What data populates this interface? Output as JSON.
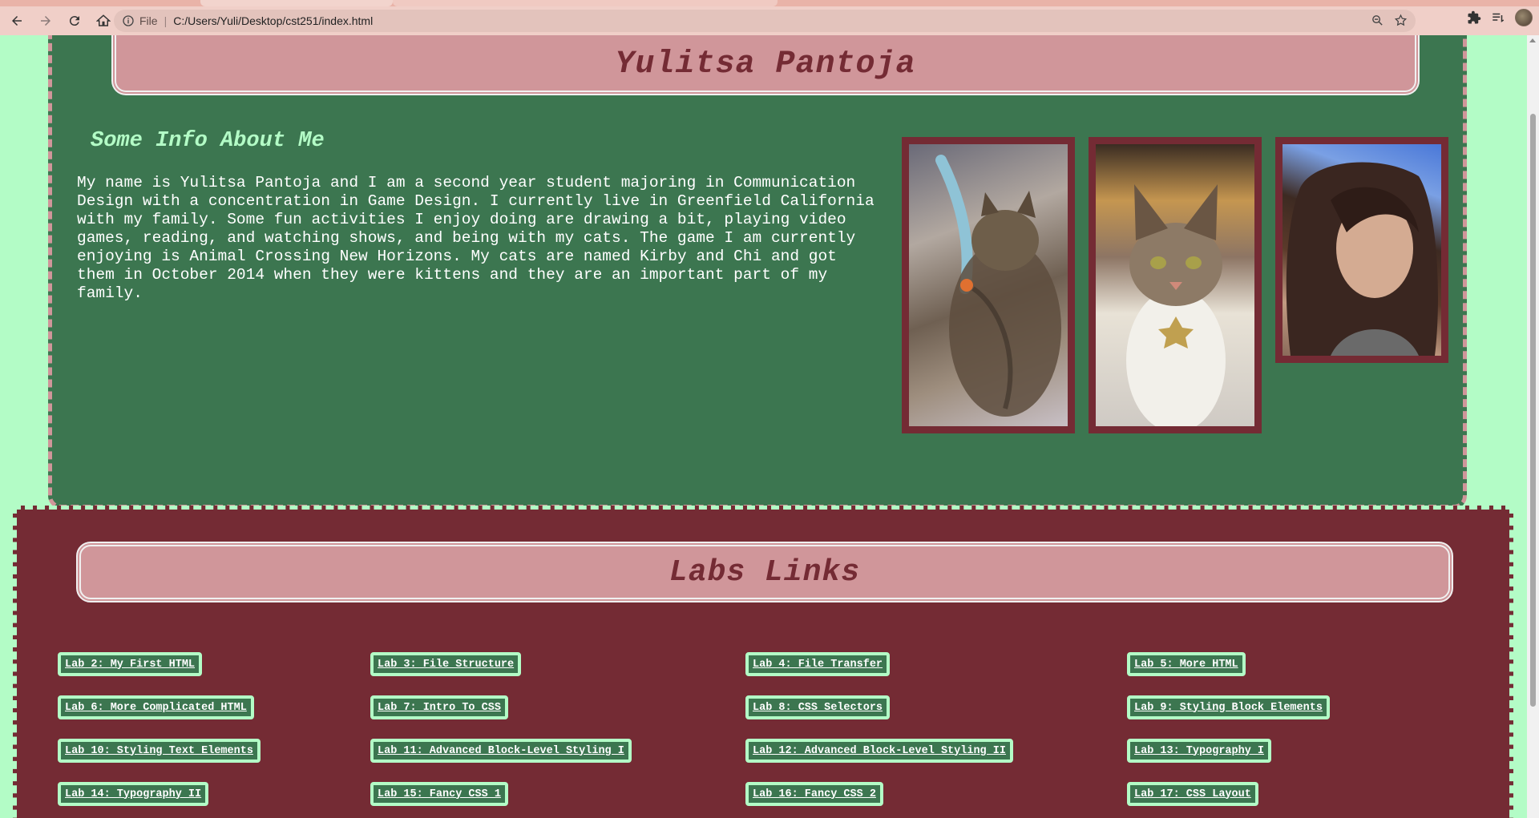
{
  "browser": {
    "omnibox": {
      "scheme_label": "File",
      "url": "C:/Users/Yuli/Desktop/cst251/index.html"
    }
  },
  "about": {
    "name": "Yulitsa Pantoja",
    "heading": "Some Info About Me",
    "paragraph": "My name is Yulitsa Pantoja and I am a second year student majoring in Communication\nDesign with a concentration in Game Design. I currently live in Greenfield California\nwith my family. Some fun activities I enjoy doing are drawing a bit, playing video\ngames, reading, and watching shows, and being with my cats. The game I am currently\nenjoying is Animal Crossing New Horizons. My cats are named Kirby and Chi and got\nthem in October 2014 when they were kittens and they are an important part of my\nfamily."
  },
  "labs": {
    "heading": "Labs Links",
    "links": [
      "Lab 2: My First HTML",
      "Lab 3: File Structure",
      "Lab 4: File Transfer",
      "Lab 5: More HTML",
      "Lab 6: More Complicated HTML",
      "Lab 7: Intro To CSS",
      "Lab 8: CSS Selectors",
      "Lab 9: Styling Block Elements",
      "Lab 10: Styling Text Elements",
      "Lab 11: Advanced Block-Level Styling I",
      "Lab 12: Advanced Block-Level Styling II",
      "Lab 13: Typography I",
      "Lab 14: Typography II",
      "Lab 15: Fancy CSS 1",
      "Lab 16: Fancy CSS 2",
      "Lab 17: CSS Layout"
    ]
  },
  "colors": {
    "page_background": "#b3fcc6",
    "green_panel": "#3c7650",
    "maroon_panel": "#742b34",
    "pink_header": "#d0969a"
  },
  "icons": [
    "back-icon",
    "forward-icon",
    "reload-icon",
    "home-icon",
    "info-icon",
    "zoom-icon",
    "bookmark-star-icon",
    "extensions-icon",
    "reading-list-icon",
    "profile-avatar"
  ]
}
